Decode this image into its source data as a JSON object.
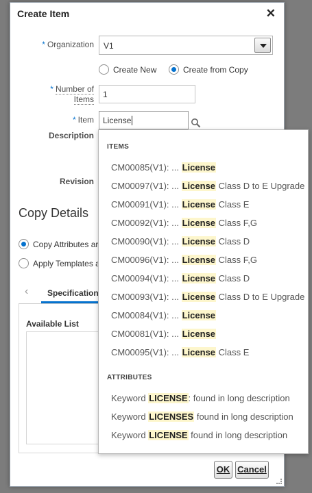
{
  "dialog": {
    "title": "Create Item",
    "close_glyph": "✕",
    "organization_label": "Organization",
    "organization_value": "V1",
    "create_new_label": "Create New",
    "create_from_copy_label": "Create from Copy",
    "number_label_line1": "Number of",
    "number_label_line2": "Items",
    "number_value": "1",
    "item_label": "Item",
    "item_value": "License",
    "description_label": "Description",
    "revision_label": "Revision",
    "copy_details_title": "Copy Details",
    "copy_attributes_label": "Copy Attributes ar",
    "apply_templates_label": "Apply Templates a",
    "tab_prev_glyph": "‹",
    "tab_specification": "Specification",
    "available_list_label": "Available List",
    "ok_label": "OK",
    "cancel_label": "Cancel"
  },
  "suggestions": {
    "items_header": "ITEMS",
    "attributes_header": "ATTRIBUTES",
    "items": [
      {
        "prefix": "CM00085(V1): ... ",
        "match": "License",
        "suffix": ""
      },
      {
        "prefix": "CM00097(V1): ... ",
        "match": "License",
        "suffix": " Class D to E Upgrade"
      },
      {
        "prefix": "CM00091(V1): ... ",
        "match": "License",
        "suffix": " Class E"
      },
      {
        "prefix": "CM00092(V1): ... ",
        "match": "License",
        "suffix": " Class F,G"
      },
      {
        "prefix": "CM00090(V1): ... ",
        "match": "License",
        "suffix": " Class D"
      },
      {
        "prefix": "CM00096(V1): ... ",
        "match": "License",
        "suffix": " Class F,G"
      },
      {
        "prefix": "CM00094(V1): ... ",
        "match": "License",
        "suffix": " Class D"
      },
      {
        "prefix": "CM00093(V1): ... ",
        "match": "License",
        "suffix": " Class D to E Upgrade"
      },
      {
        "prefix": "CM00084(V1): ... ",
        "match": "License",
        "suffix": ""
      },
      {
        "prefix": "CM00081(V1): ... ",
        "match": "License",
        "suffix": ""
      },
      {
        "prefix": "CM00095(V1): ... ",
        "match": "License",
        "suffix": " Class E"
      }
    ],
    "attributes": [
      {
        "prefix": "Keyword ",
        "match": "LICENSE",
        "suffix": ": found in long description"
      },
      {
        "prefix": "Keyword ",
        "match": "LICENSES",
        "suffix": " found in long description"
      },
      {
        "prefix": "Keyword ",
        "match": "LICENSE",
        "suffix": " found in long description"
      }
    ]
  },
  "colors": {
    "accent": "#0572ce",
    "highlight": "#fdf6cc"
  }
}
